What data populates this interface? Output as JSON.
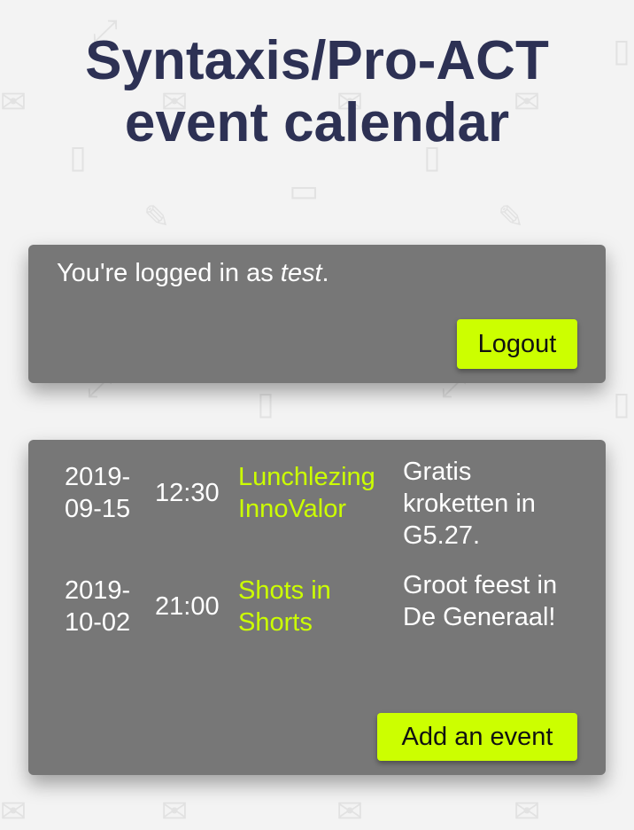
{
  "page": {
    "title_line1": "Syntaxis/Pro-ACT",
    "title_line2": "event calendar"
  },
  "login": {
    "prefix": "You're logged in as ",
    "username": "test",
    "suffix": ".",
    "logout_label": "Logout"
  },
  "events": [
    {
      "date": "2019-09-15",
      "time": "12:30",
      "name": "Lunchlezing InnoValor",
      "description": "Gratis kroketten in G5.27."
    },
    {
      "date": "2019-10-02",
      "time": "21:00",
      "name": "Shots in Shorts",
      "description": "Groot feest in De Generaal!"
    }
  ],
  "actions": {
    "add_event_label": "Add an event"
  },
  "colors": {
    "accent": "#ccff00",
    "title": "#2d3154",
    "panel": "#777777",
    "background": "#f3f3f3"
  },
  "background_icons": [
    "mail-icon",
    "phone-icon",
    "tablet-icon",
    "pencil-icon",
    "coffee-icon",
    "send-icon",
    "gear-icon",
    "expand-icon"
  ]
}
